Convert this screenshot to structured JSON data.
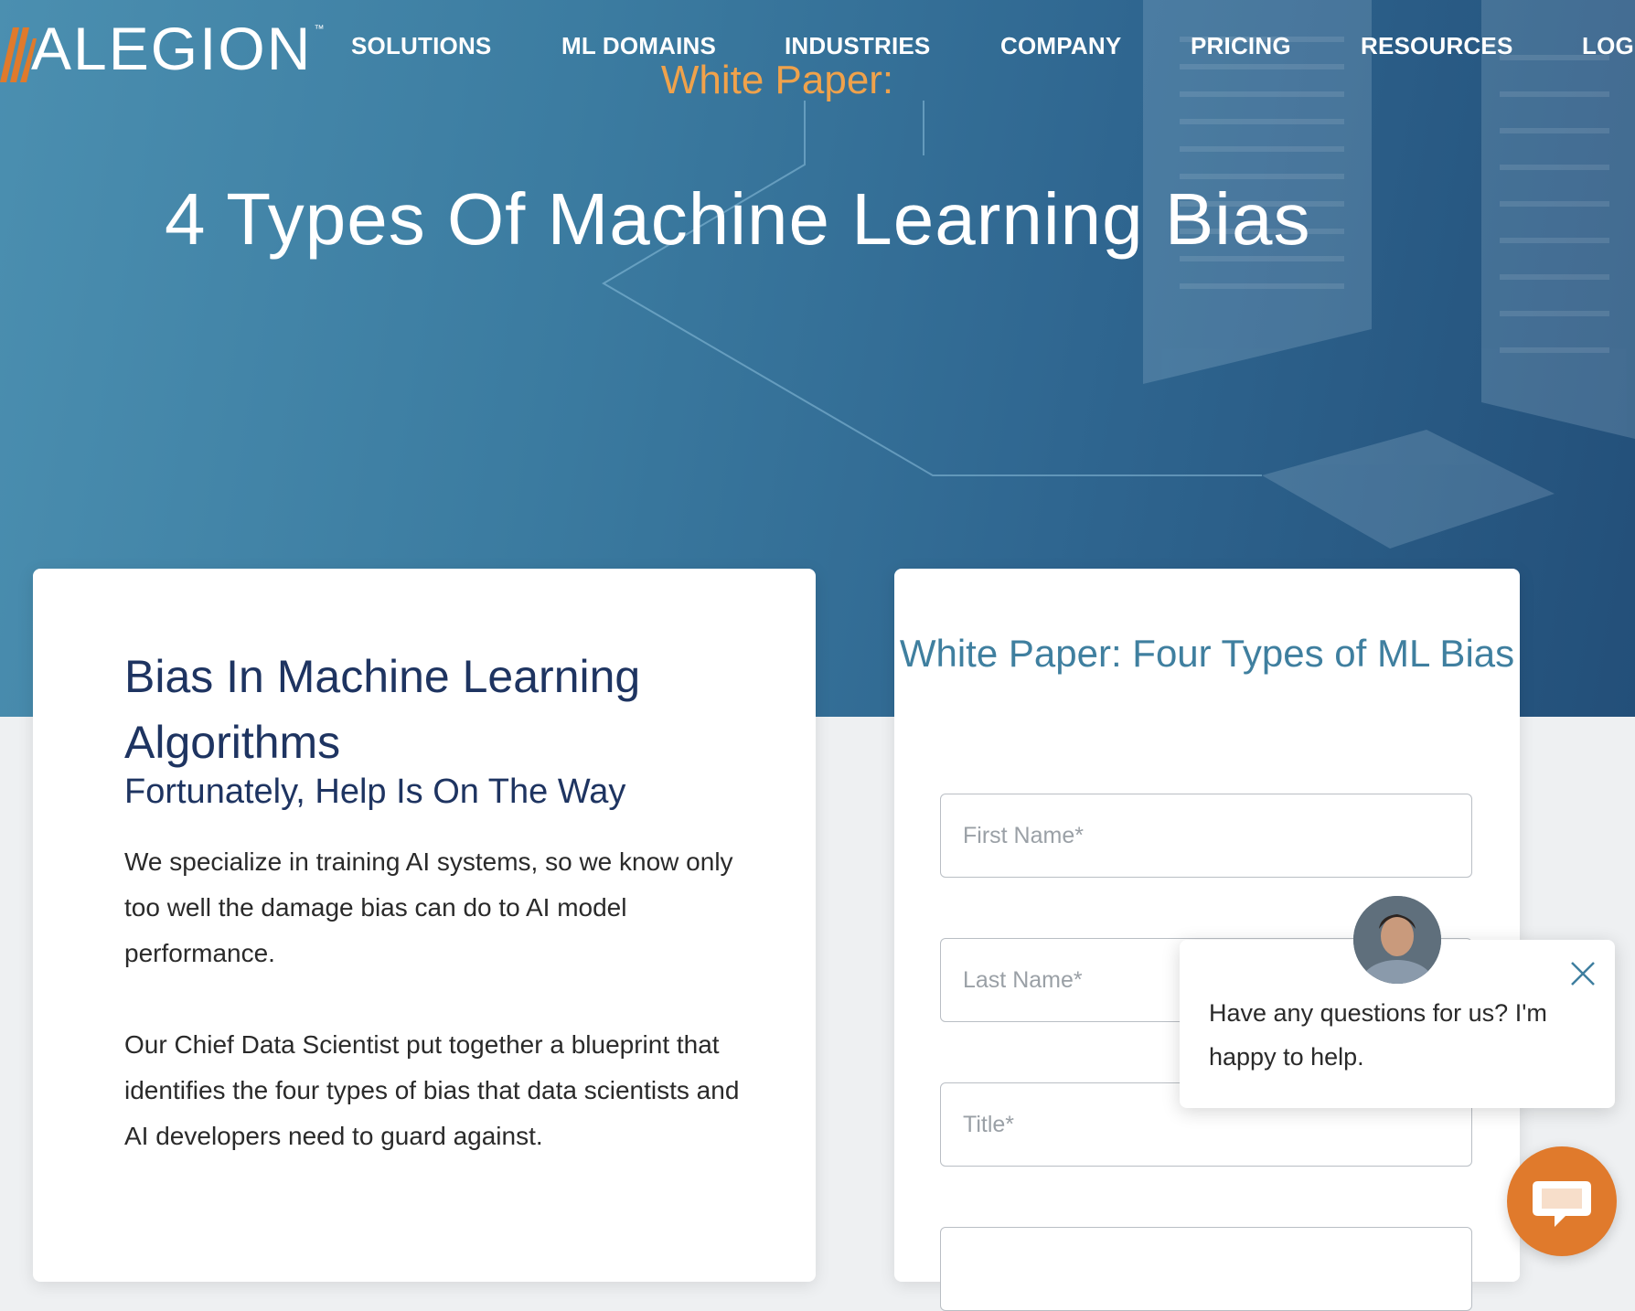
{
  "brand": {
    "name": "ALEGION",
    "trademark": "™",
    "accent_color": "#e07a2c"
  },
  "nav": {
    "items": [
      {
        "label": "SOLUTIONS"
      },
      {
        "label": "ML DOMAINS"
      },
      {
        "label": "INDUSTRIES"
      },
      {
        "label": "COMPANY"
      },
      {
        "label": "PRICING"
      },
      {
        "label": "RESOURCES"
      },
      {
        "label": "LOG"
      }
    ]
  },
  "hero": {
    "eyebrow": "White Paper:",
    "title": "4 Types Of Machine Learning Bias"
  },
  "intro": {
    "heading": "Bias In Machine Learning Algorithms",
    "subheading": "Fortunately, Help Is On The Way",
    "paragraph_1": "We specialize in training AI systems, so we know only too well the damage bias can do to AI model performance.",
    "paragraph_2": "Our Chief Data Scientist put together a blueprint that identifies the four types of bias that data scientists and AI developers need to guard against."
  },
  "form": {
    "title": "White Paper: Four Types of ML Bias",
    "fields": {
      "first_name": {
        "placeholder": "First Name*",
        "value": ""
      },
      "last_name": {
        "placeholder": "Last Name*",
        "value": ""
      },
      "title": {
        "placeholder": "Title*",
        "value": ""
      },
      "next": {
        "placeholder": "",
        "value": ""
      }
    }
  },
  "chat": {
    "message": "Have any questions for us? I'm happy to help.",
    "close_icon": "close-icon",
    "launcher_icon": "chat-bubble-icon"
  },
  "colors": {
    "hero_text": "#ffffff",
    "eyebrow": "#f0a24b",
    "heading": "#1e3461",
    "form_title": "#3f7f9f"
  }
}
